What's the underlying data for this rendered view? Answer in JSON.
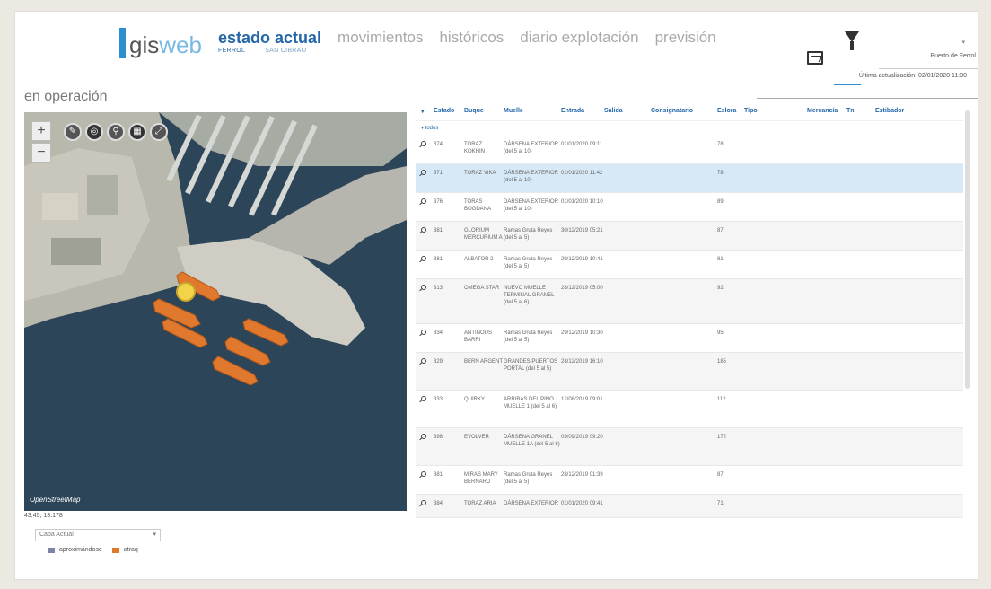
{
  "brand": {
    "gis": "gis",
    "web": "web"
  },
  "nav": {
    "active": "estado actual",
    "items": [
      "movimientos",
      "históricos",
      "diario explotación",
      "previsión"
    ],
    "sub": [
      "FERROL",
      "SAN CIBRAO"
    ]
  },
  "tools": {
    "port": "Puerto de Ferrol",
    "last_update": "Última actualización: 02/01/2020 11:00"
  },
  "section_title": "en operación",
  "map": {
    "controls": [
      "+",
      "−"
    ],
    "attribution": "OpenStreetMap",
    "coords": "43.45, 13.178"
  },
  "layer_select": "Capa Actual",
  "legend": [
    {
      "label": "aproximándose",
      "color": "#7a86a8"
    },
    {
      "label": "atraq",
      "color": "#e0782e"
    }
  ],
  "table": {
    "headers": [
      "Estado",
      "Buque",
      "Muelle",
      "Entrada",
      "Salida",
      "Consignatario",
      "Eslora",
      "Tipo",
      "Mercancía",
      "Tn",
      "Estibador"
    ],
    "filter_label": "▾ todos",
    "rows": [
      {
        "est": "374",
        "buq": "TORAZ KOKHIN",
        "mue": "DÁRSENA EXTERIOR (del 5 al 10)",
        "ent": "01/01/2020 09:11",
        "esl": "78"
      },
      {
        "est": "371",
        "buq": "TORAZ VIKA",
        "mue": "DÁRSENA EXTERIOR (del 5 al 10)",
        "ent": "01/01/2020 11:42",
        "esl": "78"
      },
      {
        "est": "376",
        "buq": "TORAS BOGDANA",
        "mue": "DÁRSENA EXTERIOR (del 5 al 10)",
        "ent": "01/01/2020 10:10",
        "esl": "89"
      },
      {
        "est": "381",
        "buq": "GLORIUM MERCURIUM A",
        "mue": "Ramas Gruta Reyes (del 5 al 5)",
        "ent": "30/12/2019 05:21",
        "esl": "87"
      },
      {
        "est": "381",
        "buq": "ALBATOR 2",
        "mue": "Ramas Gruta Reyes (del 5 al 5)",
        "ent": "29/12/2019 10:41",
        "esl": "81"
      },
      {
        "est": "313",
        "buq": "OMEGA STAR",
        "mue": "NUEVO MUELLE TERMINAL GRANEL (del 5 al 6)",
        "ent": "28/12/2019 05:00",
        "esl": "92"
      },
      {
        "est": "334",
        "buq": "ANTINOUS BARRI",
        "mue": "Ramas Gruta Reyes (del 5 al 5)",
        "ent": "29/12/2019 10:30",
        "esl": "95"
      },
      {
        "est": "329",
        "buq": "BERN ARGENT",
        "mue": "GRANDES PUERTOS PORTAL (del 5 al 5)",
        "ent": "28/12/2019 16:10",
        "esl": "185"
      },
      {
        "est": "333",
        "buq": "QUIRKY",
        "mue": "ARRIBAS DEL PINO MUELLE 1 (del 5 al 6)",
        "ent": "12/08/2019 09:01",
        "esl": "112"
      },
      {
        "est": "398",
        "buq": "EVOLVER",
        "mue": "DÁRSENA GRANEL MUELLE 1A (del 5 al 6)",
        "ent": "09/09/2019 09:20",
        "esl": "172"
      },
      {
        "est": "381",
        "buq": "MIRAS MARY BERNARD",
        "mue": "Ramas Gruta Reyes (del 5 al 5)",
        "ent": "28/12/2019 01:39",
        "esl": "87"
      },
      {
        "est": "384",
        "buq": "TORAZ ARIA",
        "mue": "DÁRSENA EXTERIOR",
        "ent": "01/01/2020 09:41",
        "esl": "71"
      }
    ]
  }
}
